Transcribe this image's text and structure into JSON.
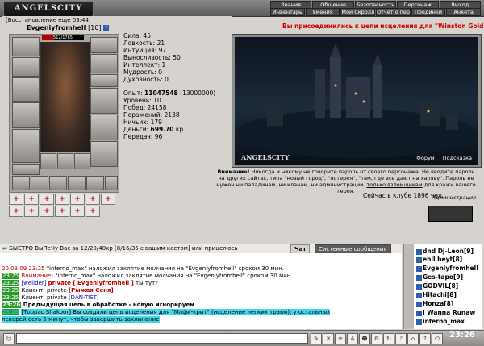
{
  "app": {
    "logo": "ANGELSCITY"
  },
  "top_menu": {
    "row1": [
      "Знания",
      "Общение",
      "Безопасность",
      "Персонаж",
      "Выход"
    ],
    "row2": [
      "Инвентарь",
      "Умения",
      "Мой Скролл",
      "Отчет о переводах",
      "Поединки",
      "Анкета"
    ]
  },
  "character": {
    "restore": "[Восстановление еще 03:44]",
    "name": "Evgeniyfromhell",
    "level": "[10]",
    "hp": "512/1765",
    "hp_fraction": 0.29,
    "stats": [
      {
        "label": "Сила:",
        "value": "45"
      },
      {
        "label": "Ловкость:",
        "value": "21"
      },
      {
        "label": "Интуиция:",
        "value": "97"
      },
      {
        "label": "Выносливость:",
        "value": "50"
      },
      {
        "label": "Интеллект:",
        "value": "1"
      },
      {
        "label": "Мудрость:",
        "value": "0"
      },
      {
        "label": "Духовность:",
        "value": "0"
      }
    ],
    "info": [
      {
        "label": "Опыт:",
        "value": "11047548",
        "extra": "(13000000)"
      },
      {
        "label": "Уровень:",
        "value": "10",
        "extra": ""
      },
      {
        "label": "Побед:",
        "value": "24158",
        "extra": ""
      },
      {
        "label": "Поражений:",
        "value": "2138",
        "extra": ""
      },
      {
        "label": "Ничьих:",
        "value": "179",
        "extra": ""
      },
      {
        "label": "Деньги:",
        "value": "699.70",
        "extra": "кр."
      },
      {
        "label": "Передач:",
        "value": "96",
        "extra": ""
      }
    ]
  },
  "main": {
    "join_message": "Вы присоединились к цепи исцеления для \"Winston Gold\"",
    "scene_logo": "ANGELSCITY",
    "scene_links": [
      "Форум",
      "Подсказка"
    ],
    "warning_title": "Внимание!",
    "warning_text": "Никогда и никому не говорите пароль от своего персонажа. Не вводите пароль на других сайтах, типа \"новый город\", \"лотерея\", \"там, где все дают на халяву\". Пароль не нужен ни паладинам, ни кланам, ни администрации,",
    "warning_link": "только взломщикам",
    "warning_tail": "для кражи вашего героя.",
    "admin": "Администрация",
    "online": "Сейчас в клубе 1896 чел."
  },
  "chat": {
    "ticker": "БЫСТРО ВыПеЧу Вас за 12/20/40кр [8/16/35 с вашим кастом] или прицелюсь",
    "tab_chat": "Чат",
    "tab_system": "Системные сообщения",
    "lines": [
      {
        "ts": "20.03.09 23:25",
        "text": "\"inferno_max\" наложил заклятие молчания на \"Evgeniyfromhell\" сроком 30 мин."
      },
      {
        "ts": "23:25",
        "prefix": "Внимание!",
        "text": "\"inferno_max\" наложил заклятие молчания на \"Evgeniyfromhell\" сроком 30 мин."
      },
      {
        "ts": "23:25",
        "nick": "[wellder]",
        "priv": "private [ Evgeniyfromhell ]",
        "text": "ты тут?"
      },
      {
        "ts": "23:25",
        "prefix": "Клиент:",
        "priv": "private",
        "text": "[Рыжая Сеня]"
      },
      {
        "ts": "23:25",
        "prefix": "Клиент:",
        "priv": "private",
        "text": "[DAN-TIST]"
      },
      {
        "ts": "23:26",
        "text": "Предыдущая цепь в обработке - новую игнорируем"
      },
      {
        "ts": "23:26",
        "nick": "[Тоорас Shakoor]",
        "text": "Вы создали цепь исцеления для \"Мафи-крит\" (исцеление легких травм), у остальных"
      },
      {
        "text": "лекарей есть 5 минут, чтобы завершить заклинание"
      }
    ]
  },
  "userlist": [
    "dnd Dj-Leon[9]",
    "ehll beyt[8]",
    "Evgeniyfromhell",
    "Ges-tapo[9]",
    "GODVIL[8]",
    "Hitachi[8]",
    "Honza[8]",
    "I Wanna Runaw",
    "inferno_max"
  ],
  "bottom": {
    "clock": "23:26"
  }
}
